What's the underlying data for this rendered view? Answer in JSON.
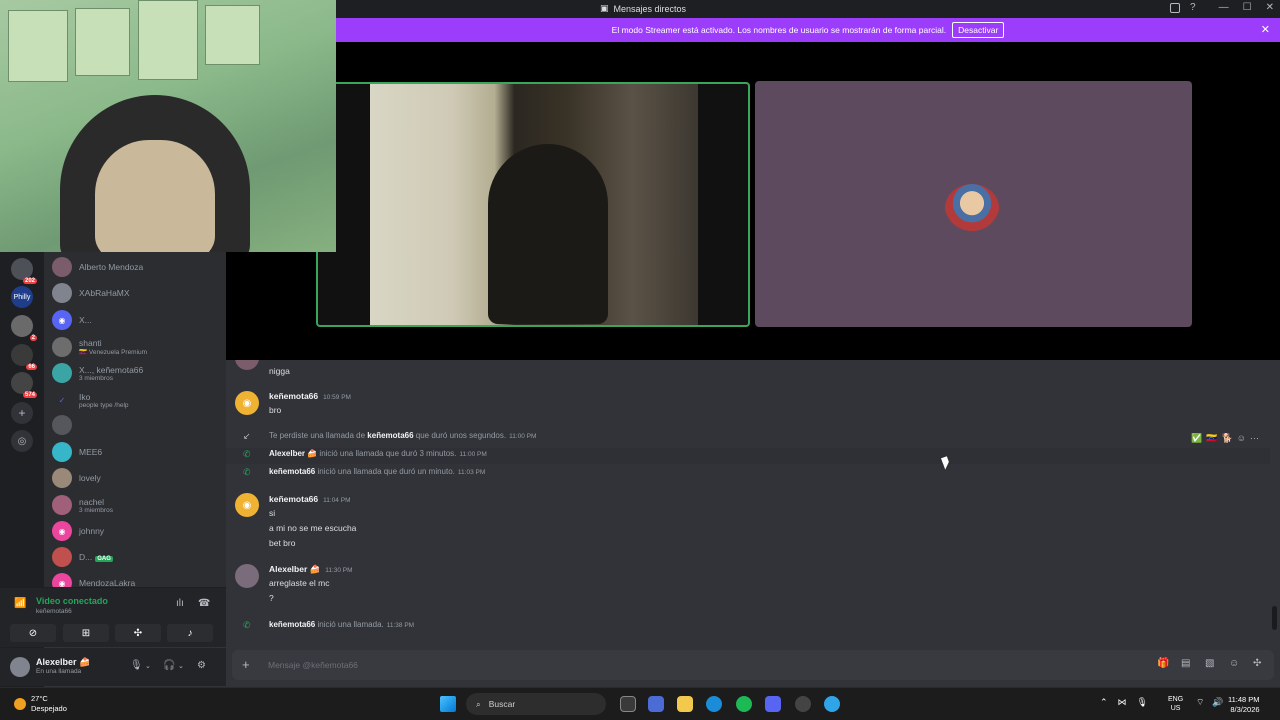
{
  "window": {
    "title": "Mensajes directos"
  },
  "banner": {
    "text": "El modo Streamer está activado. Los nombres de usuario se mostrarán de forma parcial.",
    "button": "Desactivar"
  },
  "guilds": [
    {
      "label": "",
      "badge": "202"
    },
    {
      "label": "Philly",
      "badge": ""
    },
    {
      "label": "",
      "badge": "2"
    },
    {
      "label": "",
      "badge": "66"
    },
    {
      "label": "",
      "badge": "574"
    }
  ],
  "dms": [
    {
      "name": "Alberto Mendoza",
      "sub": "",
      "tag": ""
    },
    {
      "name": "XAbRaHaMX",
      "sub": "",
      "tag": ""
    },
    {
      "name": "X...",
      "sub": "",
      "tag": ""
    },
    {
      "name": "shanti",
      "sub": "🇻🇪 Venezuela Premium",
      "tag": ""
    },
    {
      "name": "X..., keñemota66",
      "sub": "3 miembros",
      "tag": ""
    },
    {
      "name": "Iko",
      "sub": "people type /help",
      "tag": ""
    },
    {
      "name": "",
      "sub": "",
      "tag": ""
    },
    {
      "name": "MEE6",
      "sub": "",
      "tag": ""
    },
    {
      "name": "lovely",
      "sub": "",
      "tag": ""
    },
    {
      "name": "nachel",
      "sub": "3 miembros",
      "tag": ""
    },
    {
      "name": "johnny",
      "sub": "",
      "tag": ""
    },
    {
      "name": "D...",
      "sub": "",
      "tag": "GAG"
    },
    {
      "name": "MendozaLakra",
      "sub": "",
      "tag": ""
    }
  ],
  "voice": {
    "status": "Video conectado",
    "channel": "keñemota66"
  },
  "user": {
    "name": "Alexelber 🍰",
    "status": "En una llamada"
  },
  "chat": {
    "top_line": "nigga",
    "groups": [
      {
        "author": "keñemota66",
        "time": "10:59 PM",
        "lines": [
          "bro"
        ]
      },
      {
        "author": "keñemota66",
        "time": "11:04 PM",
        "lines": [
          "si",
          "a mi no se me escucha",
          "bet bro"
        ]
      },
      {
        "author": "Alexelber 🍰",
        "time": "11:30 PM",
        "lines": [
          "arreglaste el mc",
          "?"
        ]
      }
    ],
    "system": [
      {
        "pre": "Te perdiste una llamada de ",
        "who": "keñemota66",
        "post": " que duró unos segundos.",
        "time": "11:00 PM"
      },
      {
        "pre": "",
        "who": "Alexelber 🍰",
        "post": " inició una llamada que duró 3 minutos.",
        "time": "11:00 PM"
      },
      {
        "pre": "",
        "who": "keñemota66",
        "post": " inició una llamada que duró un minuto.",
        "time": "11:03 PM"
      },
      {
        "pre": "",
        "who": "keñemota66",
        "post": " inició una llamada.",
        "time": "11:38 PM"
      }
    ],
    "toolbar_more": "···"
  },
  "composer": {
    "placeholder": "Mensaje @keñemota66"
  },
  "taskbar": {
    "temp": "27°C",
    "weather": "Despejado",
    "search": "Buscar",
    "lang1": "ENG",
    "lang2": "US",
    "time": "11:48 PM",
    "date": "8/3/2026"
  }
}
